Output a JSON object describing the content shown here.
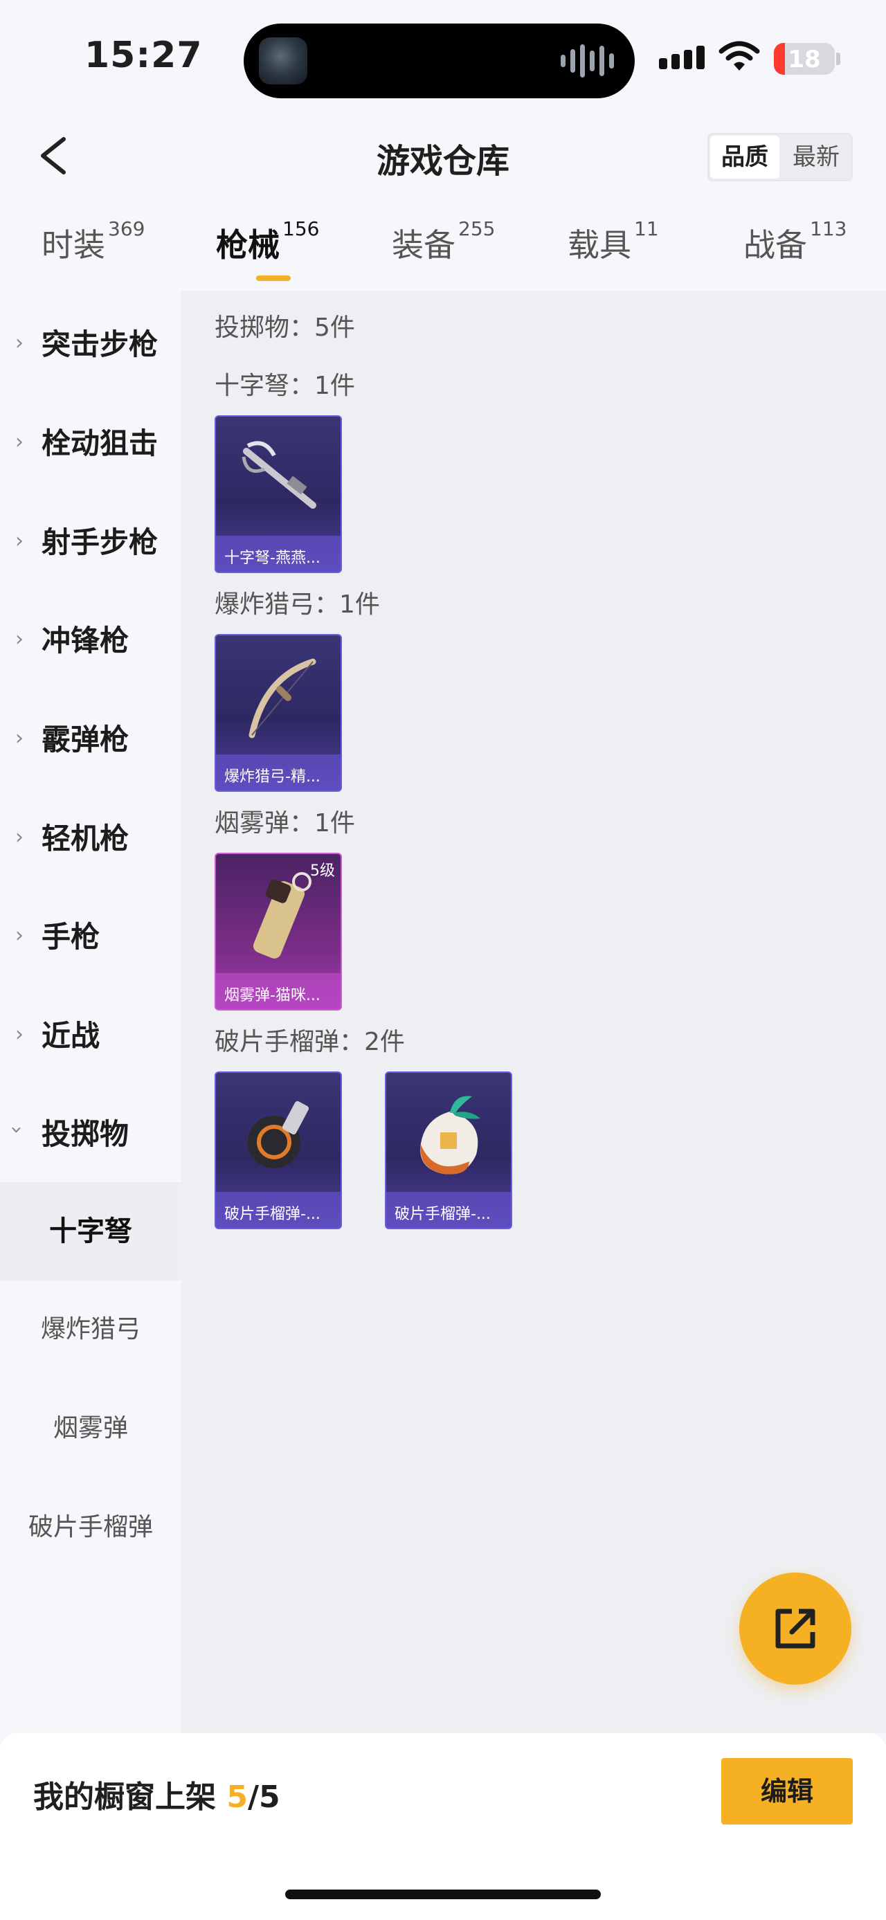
{
  "status_bar": {
    "time": "15:27",
    "battery": "18"
  },
  "header": {
    "title": "游戏仓库",
    "sort_quality": "品质",
    "sort_newest": "最新"
  },
  "tabs": [
    {
      "label": "时装",
      "count": "369"
    },
    {
      "label": "枪械",
      "count": "156",
      "active": true
    },
    {
      "label": "装备",
      "count": "255"
    },
    {
      "label": "载具",
      "count": "11"
    },
    {
      "label": "战备",
      "count": "113"
    }
  ],
  "sidebar": {
    "categories": [
      "突击步枪",
      "栓动狙击",
      "射手步枪",
      "冲锋枪",
      "霰弹枪",
      "轻机枪",
      "手枪",
      "近战",
      "投掷物"
    ],
    "subcategories": [
      "十字弩",
      "爆炸猎弓",
      "烟雾弹",
      "破片手榴弹"
    ],
    "active_subcategory": "十字弩"
  },
  "content": {
    "group_header": "投掷物：5件",
    "sections": [
      {
        "title": "十字弩：1件",
        "items": [
          {
            "name": "十字弩-燕燕...",
            "rarity": "purple"
          }
        ]
      },
      {
        "title": "爆炸猎弓：1件",
        "items": [
          {
            "name": "爆炸猎弓-精...",
            "rarity": "purple"
          }
        ]
      },
      {
        "title": "烟雾弹：1件",
        "items": [
          {
            "name": "烟雾弹-猫咪...",
            "rarity": "pink",
            "level": "5级"
          }
        ]
      },
      {
        "title": "破片手榴弹：2件",
        "items": [
          {
            "name": "破片手榴弹-...",
            "rarity": "purple"
          },
          {
            "name": "破片手榴弹-...",
            "rarity": "purple"
          }
        ]
      }
    ]
  },
  "footer": {
    "shelf_label": "我的橱窗上架",
    "shelf_used": "5",
    "shelf_total": "/5",
    "edit_label": "编辑"
  },
  "colors": {
    "accent": "#f4b02b",
    "purple_card": "#3a3575",
    "pink_card": "#7a2d86"
  },
  "icons": {
    "back": "chevron-left-icon",
    "fab": "share-external-icon",
    "wifi": "wifi-icon",
    "signal": "cell-signal-icon"
  }
}
